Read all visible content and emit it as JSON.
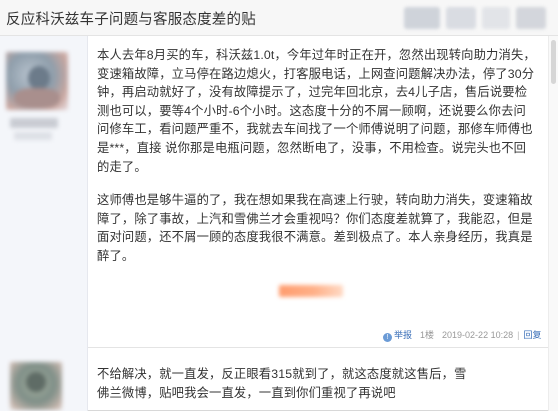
{
  "thread": {
    "title": "反应科沃兹车子问题与客服态度差的贴"
  },
  "post1": {
    "paragraph1": "本人去年8月买的车，科沃兹1.0t，今年过年时正在开，忽然出现转向助力消失，变速箱故障，立马停在路边熄火，打客服电话，上网查问题解决办法，停了30分钟，再启动就好了，没有故障提示了，过完年回北京，去4儿子店，售后说要检测也可以，要等4个小时-6个小时。这态度十分的不屑一顾啊，还说要么你去问问修车工，看问题严重不，我就去车间找了一个师傅说明了问题，那修车师傅也是***，直接 说你那是电瓶问题，忽然断电了，没事，不用检查。说完头也不回的走了。",
    "paragraph2": "这师傅也是够牛逼的了，我在想如果我在高速上行驶，转向助力消失，变速箱故障了，除了事故，上汽和雪佛兰才会重视吗？你们态度差就算了，我能忍，但是面对问题，还不屑一顾的态度我很不满意。差到极点了。本人亲身经历，我真是醉了。",
    "meta": {
      "report_label": "举报",
      "floor_label": "1楼",
      "timestamp": "2019-02-22 10:28",
      "reply_label": "回复"
    }
  },
  "post2": {
    "paragraph1": "不给解决，就一直发，反正眼看315就到了，就这态度就这售后，雪佛兰微博，贴吧我会一直发，一直到你们重视了再说吧"
  },
  "colors": {
    "link_blue": "#3a6fb8",
    "sidebar_bg": "#f4f6fa",
    "muted_text": "#999999"
  }
}
